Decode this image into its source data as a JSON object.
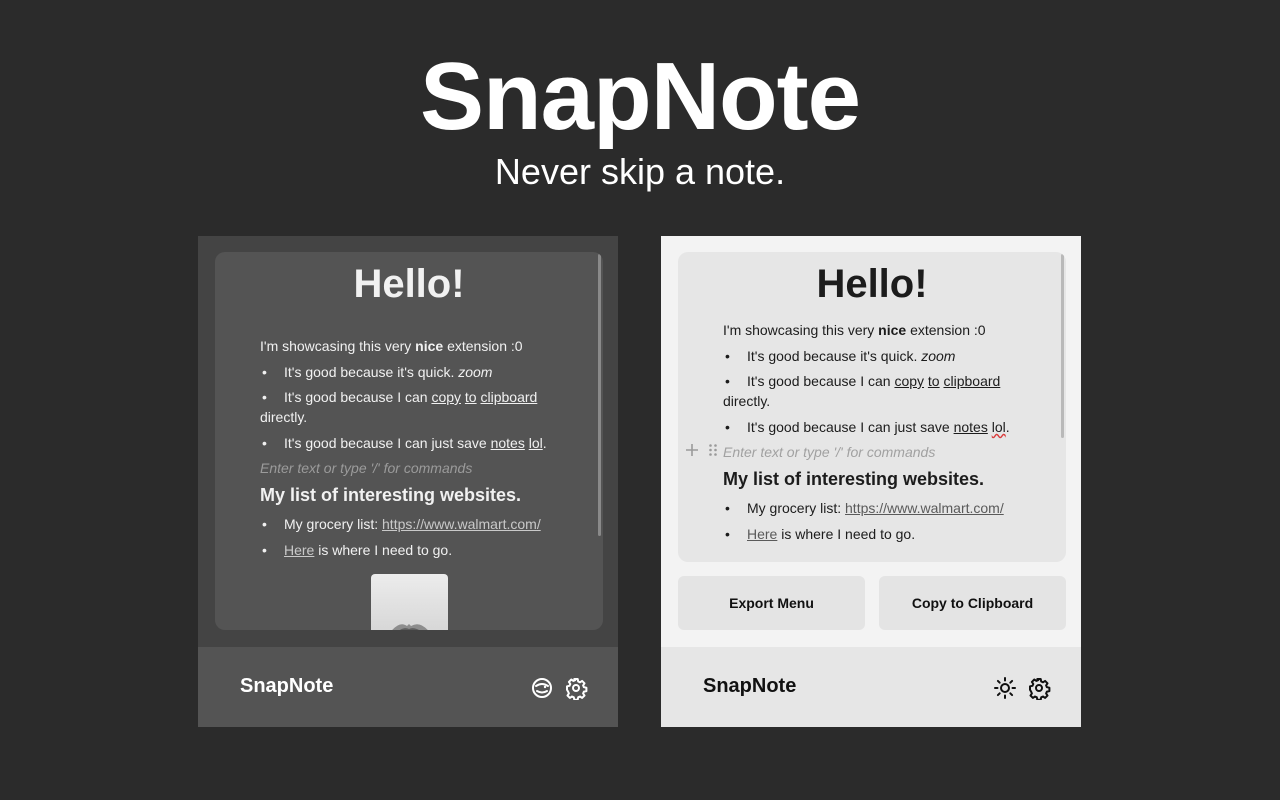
{
  "hero": {
    "title": "SnapNote",
    "subtitle": "Never skip a note."
  },
  "note": {
    "title": "Hello!",
    "intro_pre": "I'm showcasing this very ",
    "intro_bold": "nice",
    "intro_post": " extension :0",
    "bullet1_text": "It's good because it's quick. ",
    "bullet1_italic": "zoom",
    "bullet2_pre": "It's good because I can ",
    "bullet2_w1": "copy",
    "bullet2_w2": "to",
    "bullet2_w3": "clipboard",
    "bullet2_cont": "directly.",
    "bullet3_pre": "It's good because I can just save ",
    "bullet3_w1": "notes",
    "bullet3_w2": "lol",
    "bullet3_end": ".",
    "placeholder": "Enter text or type '/' for commands",
    "heading": "My list of interesting websites.",
    "site1_label": "My grocery list: ",
    "site1_url": "https://www.walmart.com/",
    "site2_link": "Here",
    "site2_text": " is where I need to go.",
    "bullet_char": "•"
  },
  "buttons": {
    "export": "Export Menu",
    "copy": "Copy to Clipboard"
  },
  "footer": {
    "title": "SnapNote"
  },
  "icons": {
    "dark_theme_toggle": "moon-face-icon",
    "light_theme_toggle": "sun-icon",
    "settings": "gear-icon",
    "add_block": "plus-icon",
    "drag_handle": "drag-handle-icon"
  },
  "colors": {
    "background": "#2b2b2b",
    "dark_panel": "#444444",
    "dark_editor": "#545454",
    "light_panel": "#f3f3f3",
    "light_editor": "#e6e6e6"
  }
}
